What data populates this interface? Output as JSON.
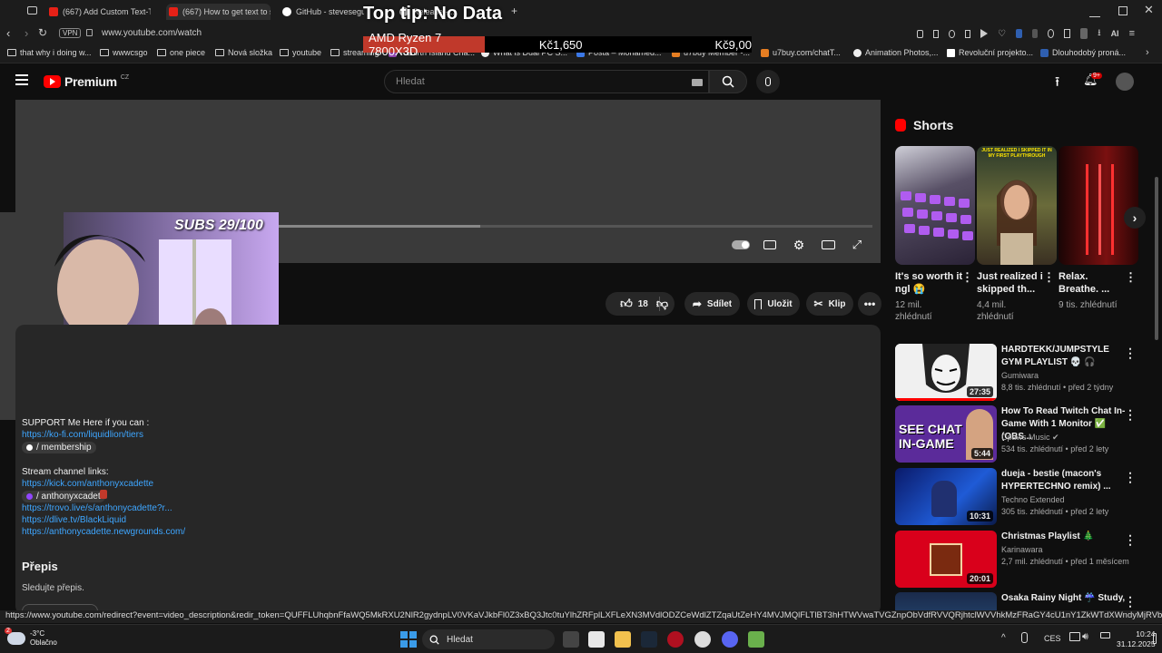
{
  "browser": {
    "tabs": [
      {
        "label": "(667) Add Custom Text-To",
        "color": "#e62117"
      },
      {
        "label": "(667) How to get text to sc",
        "color": "#e62117"
      },
      {
        "label": "GitHub - stevesegui...",
        "color": "#ffffff"
      },
      {
        "label": "Release - ...",
        "color": "#cccccc"
      }
    ],
    "new_tab": "+",
    "vpn": "VPN",
    "url": "www.youtube.com/watch",
    "bookmarks": [
      "that why i doing w...",
      "wwwcsgo",
      "one piece",
      "Nová složka",
      "youtube",
      "streaming",
      "Rebirth Island Cha...",
      "What is Dual PC S...",
      "Pošta – Mohamed...",
      "u7buy Member -...",
      "u7buy.com/chatT...",
      "Animation Photos,...",
      "Revoluční projekto...",
      "Dlouhodobý proná..."
    ],
    "ai_label": "AI"
  },
  "overlay": {
    "tip": "Top tip: No Data",
    "cpu": "AMD Ryzen 7 7800X3D",
    "price1": "Kč1,650",
    "price2": "Kč9,00"
  },
  "youtube": {
    "logo": "Premium",
    "region": "CZ",
    "search_placeholder": "Hledat",
    "notif_count": "9+"
  },
  "webcam": {
    "subs": "SUBS 29/100"
  },
  "actions": {
    "likes": "18",
    "share": "Sdílet",
    "save": "Uložit",
    "clip": "Klip"
  },
  "description": {
    "support": "SUPPORT Me Here if you can :",
    "kofi": "https://ko-fi.com/liquidlion/tiers",
    "membership": "/ membership",
    "stream_links": "Stream channel links:",
    "kick": "https://kick.com/anthonyxcadette",
    "twitch": "/ anthonyxcadet",
    "trovo": "https://trovo.live/s/anthonycadette?r...",
    "dlive": "https://dlive.tv/BlackLiquid",
    "newgrounds": "https://anthonycadette.newgrounds.com/",
    "transcript_heading": "Přepis",
    "transcript_sub": "Sledujte přepis."
  },
  "shorts": {
    "heading": "Shorts",
    "items": [
      {
        "title": "It's so worth it ngl 😭",
        "views1": "12 mil.",
        "views2": "zhlédnutí"
      },
      {
        "title": "Just realized i skipped th...",
        "views1": "4,4 mil.",
        "views2": "zhlédnutí"
      },
      {
        "title": "Relax. Breathe. ...",
        "views1": "9 tis. zhlédnutí",
        "views2": ""
      }
    ],
    "thumb2_caption": "JUST REALIZED I SKIPPED IT IN MY FIRST PLAYTHROUGH"
  },
  "recommended": [
    {
      "title": "HARDTEKK/JUMPSTYLE GYM PLAYLIST 💀 🎧",
      "channel": "Gumiwara",
      "meta": "8,8 tis. zhlédnutí • před 2 týdny",
      "duration": "27:35"
    },
    {
      "title": "How To Read Twitch Chat In-Game With 1 Monitor ✅ (OBS...",
      "channel": "Cpaws Music",
      "meta": "534 tis. zhlédnutí • před 2 lety",
      "duration": "5:44",
      "thumb_text": "SEE CHAT IN-GAME"
    },
    {
      "title": "dueja - bestie (macon's HYPERTECHNO remix) ...",
      "channel": "Techno Extended",
      "meta": "305 tis. zhlédnutí • před 2 lety",
      "duration": "10:31"
    },
    {
      "title": "Christmas Playlist 🎄",
      "channel": "Karinawara",
      "meta": "2,7 mil. zhlédnutí • před 1 měsícem",
      "duration": "20:01"
    },
    {
      "title": "Osaka Rainy Night ☔ Study,",
      "channel": "",
      "meta": "",
      "duration": ""
    }
  ],
  "status_url": "https://www.youtube.com/redirect?event=video_description&redir_token=QUFFLUhqbnFfaWQ5MkRXU2NlR2gydnpLV0VKaVJkbFl0Z3xBQ3Jtc0tuYlhZRFplLXFLeXN3MVdlODZCeWdlZTZqaUtZeHY4MVJMQlFLTlBT3hHTWVwaTVGZnpObVdfRVVQRjhtclWVVhkMzFRaGY4cU1nY1ZkWTdXWndyMjRVbkoySDl4R...",
  "taskbar": {
    "temp": "-3°C",
    "weather": "Oblačno",
    "weather_badge": "2",
    "search": "Hledat",
    "lang": "CES",
    "time": "10:24",
    "date": "31.12.2025"
  }
}
